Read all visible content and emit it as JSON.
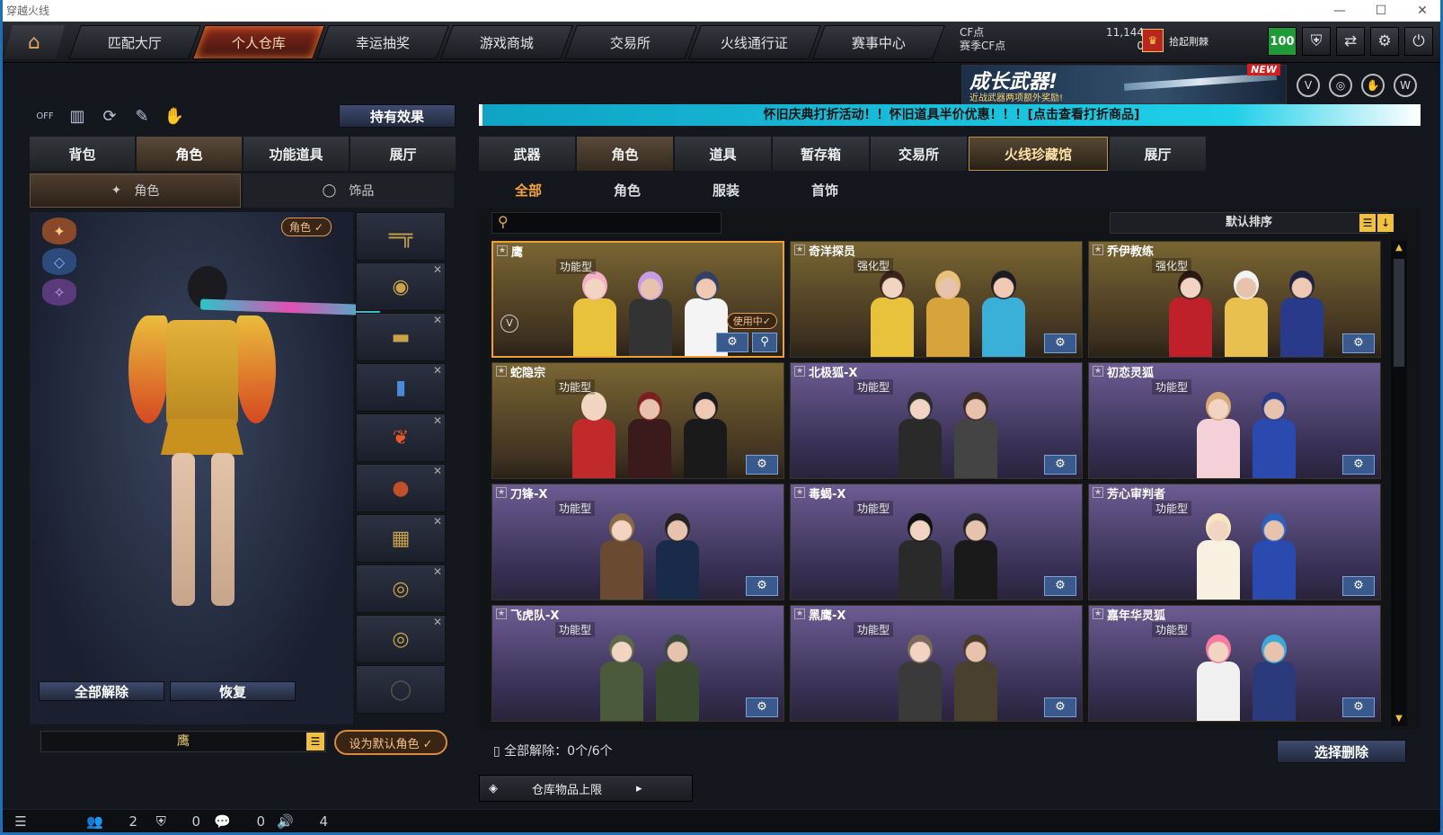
{
  "window": {
    "title": "穿越火线",
    "min": "—",
    "max": "☐",
    "close": "✕"
  },
  "nav": {
    "home_icon": "home-icon",
    "tabs": [
      "匹配大厅",
      "个人仓库",
      "幸运抽奖",
      "游戏商城",
      "交易所",
      "火线通行证",
      "赛事中心"
    ],
    "active_tab": "个人仓库"
  },
  "currency": {
    "cf_label": "CF点",
    "cf_value": "11,144",
    "season_label": "赛季CF点",
    "season_value": "0",
    "rank_name": "拾起荆棘",
    "rank_badge": "♛",
    "level": "100"
  },
  "top_icons": [
    "shield-icon",
    "exchange-icon",
    "gear-icon",
    "power-icon"
  ],
  "banner": {
    "title": "成长武器!",
    "subtitle": "近战武器两项额外奖励!",
    "badge": "NEW"
  },
  "left": {
    "effect_button": "持有效果",
    "tabs": [
      "背包",
      "角色",
      "功能道具",
      "展厅"
    ],
    "active_tab": "角色",
    "subtabs": [
      {
        "label": "角色",
        "icon": "character-icon"
      },
      {
        "label": "饰品",
        "icon": "ring-icon"
      }
    ],
    "char_tag": "角色 ✓",
    "unequip_all": "全部解除",
    "restore": "恢复",
    "char_name": "鹰",
    "set_default": "设为默认角色 ✓",
    "small_icons": [
      "OFF",
      "📊",
      "⟳",
      "✎",
      "🖐"
    ]
  },
  "right": {
    "promo": "怀旧庆典打折活动！！怀旧道具半价优惠！！！[点击查看打折商品]",
    "tabs": [
      "武器",
      "角色",
      "道具",
      "暂存箱",
      "交易所",
      "火线珍藏馆",
      "展厅"
    ],
    "active_tab": "角色",
    "subtabs": [
      "全部",
      "角色",
      "服装",
      "首饰"
    ],
    "active_subtab": "全部",
    "search_placeholder": "",
    "sort_label": "默认排序",
    "cards": [
      {
        "name": "鹰",
        "type": "功能型",
        "theme": "gold",
        "in_use": "使用中✓",
        "selected": true
      },
      {
        "name": "奇洋探员",
        "type": "强化型",
        "theme": "gold"
      },
      {
        "name": "乔伊教练",
        "type": "强化型",
        "theme": "gold"
      },
      {
        "name": "蛇隐宗",
        "type": "功能型",
        "theme": "gold"
      },
      {
        "name": "北极狐-X",
        "type": "功能型",
        "theme": "purple"
      },
      {
        "name": "初恋灵狐",
        "type": "功能型",
        "theme": "purple"
      },
      {
        "name": "刀锋-X",
        "type": "功能型",
        "theme": "purple"
      },
      {
        "name": "毒蝎-X",
        "type": "功能型",
        "theme": "purple"
      },
      {
        "name": "芳心审判者",
        "type": "功能型",
        "theme": "purple"
      },
      {
        "name": "飞虎队-X",
        "type": "功能型",
        "theme": "purple"
      },
      {
        "name": "黑鹰-X",
        "type": "功能型",
        "theme": "purple"
      },
      {
        "name": "嘉年华灵狐",
        "type": "功能型",
        "theme": "purple"
      }
    ],
    "unequip_info": "全部解除：0个/6个",
    "delete_button": "选择删除",
    "capacity_label": "仓库物品上限"
  },
  "status": {
    "a": "2",
    "b": "0",
    "c": "0",
    "d": "4"
  }
}
